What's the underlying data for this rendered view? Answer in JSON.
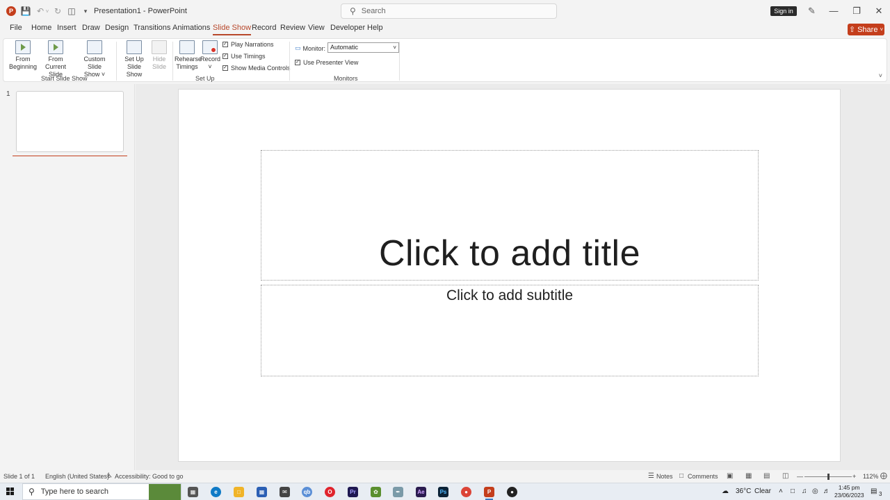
{
  "titlebar": {
    "doc_title": "Presentation1 - PowerPoint",
    "search_placeholder": "Search",
    "signin_label": "Sign in"
  },
  "tabs": [
    "File",
    "Home",
    "Insert",
    "Draw",
    "Design",
    "Transitions",
    "Animations",
    "Slide Show",
    "Record",
    "Review",
    "View",
    "Developer",
    "Help"
  ],
  "active_tab": "Slide Show",
  "share_label": "Share",
  "ribbon": {
    "from_beginning": "From Beginning",
    "from_beginning_l1": "From",
    "from_beginning_l2": "Beginning",
    "from_current_l1": "From",
    "from_current_l2": "Current Slide",
    "custom_l1": "Custom Slide",
    "custom_l2": "Show",
    "group_start": "Start Slide Show",
    "setup_l1": "Set Up",
    "setup_l2": "Slide Show",
    "hide_l1": "Hide",
    "hide_l2": "Slide",
    "rehearse_l1": "Rehearse",
    "rehearse_l2": "Timings",
    "record_label": "Record",
    "play_narrations": "Play Narrations",
    "use_timings": "Use Timings",
    "show_media_controls": "Show Media Controls",
    "group_setup": "Set Up",
    "monitor_label": "Monitor:",
    "monitor_value": "Automatic",
    "use_presenter_view": "Use Presenter View",
    "group_monitors": "Monitors"
  },
  "thumbnails": {
    "slide_number": "1"
  },
  "slide": {
    "title_placeholder": "Click to add title",
    "subtitle_placeholder": "Click to add subtitle"
  },
  "statusbar": {
    "slide_count": "Slide 1 of 1",
    "language": "English (United States)",
    "accessibility": "Accessibility: Good to go",
    "notes": "Notes",
    "comments": "Comments",
    "zoom": "112%"
  },
  "taskbar": {
    "search_placeholder": "Type here to search",
    "temperature": "36°C",
    "weather": "Clear",
    "time": "1:45 pm",
    "date": "23/06/2023",
    "notification_count": "3"
  },
  "colors": {
    "accent": "#c43e1c",
    "tab_active": "#b7472a"
  }
}
